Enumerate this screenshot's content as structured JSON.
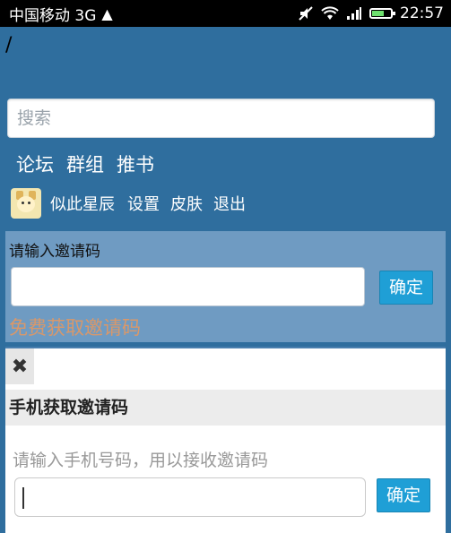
{
  "status_bar": {
    "carrier": "中国移动 3G",
    "warning_icon": "warning-triangle-icon",
    "mute_icon": "muted-icon",
    "wifi_icon": "wifi-icon",
    "signal_icon": "signal-bars-icon",
    "battery_icon": "battery-icon",
    "time": "22:57"
  },
  "header": {
    "path": "/"
  },
  "search": {
    "placeholder": "搜索",
    "value": ""
  },
  "nav": {
    "items": [
      "论坛",
      "群组",
      "推书"
    ]
  },
  "user": {
    "name": "似此星辰",
    "links": [
      "设置",
      "皮肤",
      "退出"
    ]
  },
  "invite": {
    "title": "请输入邀请码",
    "input_value": "",
    "confirm_label": "确定",
    "free_link": "免费获取邀请码"
  },
  "phone_panel": {
    "close_symbol": "✖",
    "title": "手机获取邀请码",
    "label": "请输入手机号码，用以接收邀请码",
    "input_value": "",
    "confirm_label": "确定"
  },
  "colors": {
    "background": "#2f6e9e",
    "invite_bg": "#6f9bc2",
    "button": "#1f9fd6",
    "free_link": "#d9986a"
  }
}
